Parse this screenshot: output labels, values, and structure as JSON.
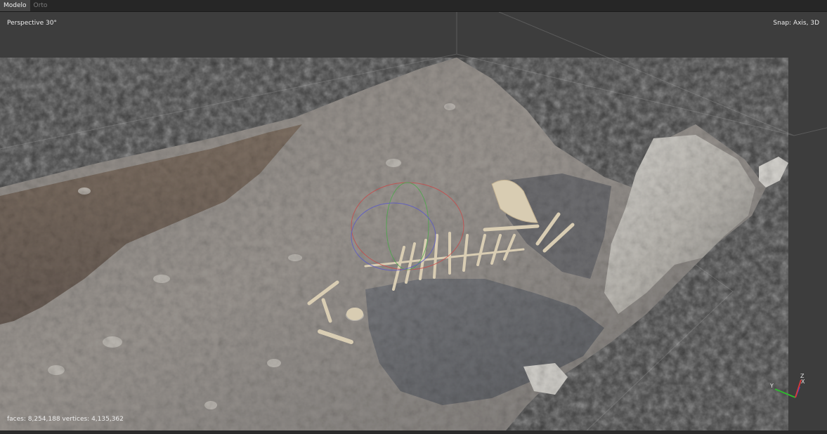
{
  "tabs": [
    {
      "label": "Modelo",
      "active": true
    },
    {
      "label": "Orto",
      "active": false
    }
  ],
  "viewport": {
    "projection_label": "Perspective 30°",
    "snap_label": "Snap: Axis, 3D",
    "stats_label": "faces: 8,254,188 vertices: 4,135,362"
  },
  "axis_gizmo": {
    "x_label": "X",
    "y_label": "Y",
    "z_label": "Z",
    "x_color": "#3b3bd6",
    "y_color": "#2fb82f",
    "z_color": "#d63a3a"
  },
  "colors": {
    "background": "#3d3d3d",
    "tabbar": "#262626",
    "active_tab": "#454545"
  }
}
